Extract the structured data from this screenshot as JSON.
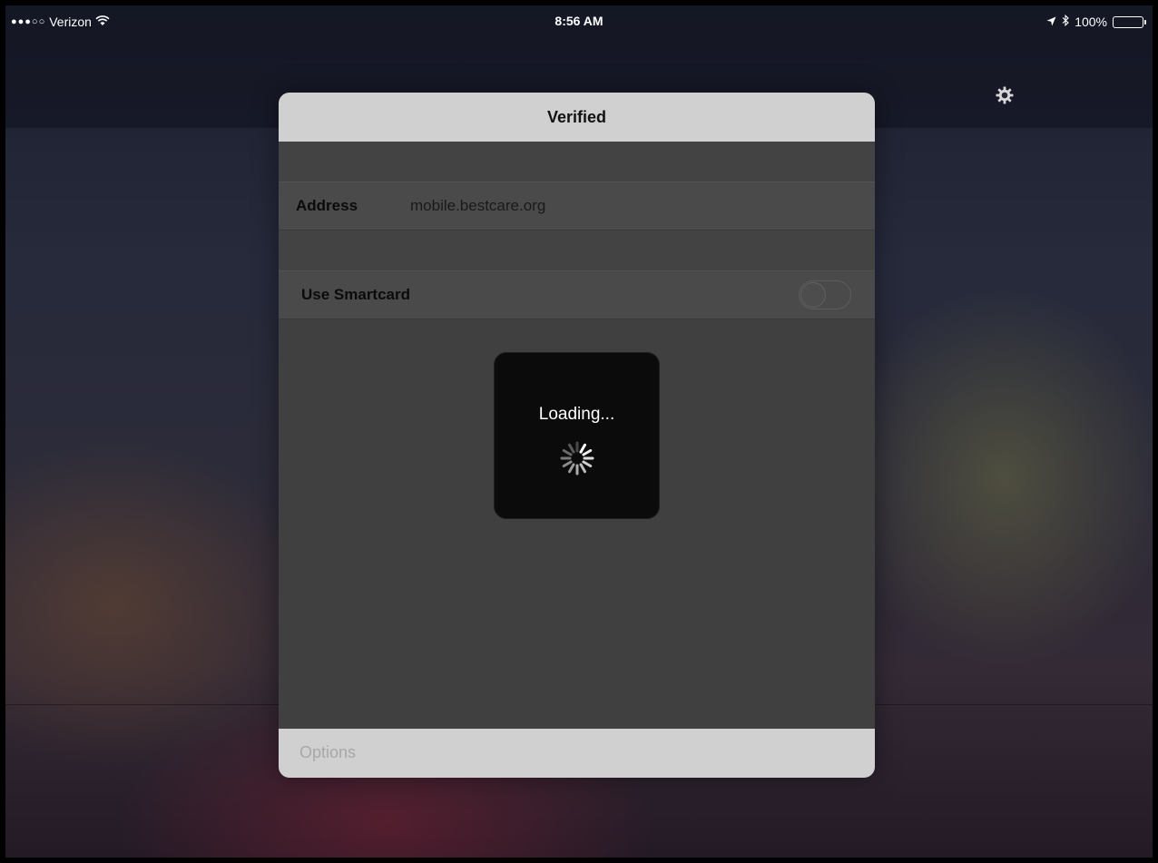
{
  "status_bar": {
    "signal_dots": "●●●○○",
    "carrier": "Verizon",
    "time": "8:56 AM",
    "battery_percent": "100%",
    "battery_level": 1.0
  },
  "modal": {
    "title": "Verified",
    "address_label": "Address",
    "address_value": "mobile.bestcare.org",
    "smartcard_label": "Use Smartcard",
    "smartcard_enabled": false,
    "loading_text": "Loading...",
    "options_label": "Options"
  },
  "icons": {
    "wifi": "wifi-icon",
    "location": "location-arrow-icon",
    "bluetooth": "bluetooth-icon",
    "battery": "battery-icon",
    "settings": "gear-icon",
    "spinner": "activity-spinner-icon"
  }
}
